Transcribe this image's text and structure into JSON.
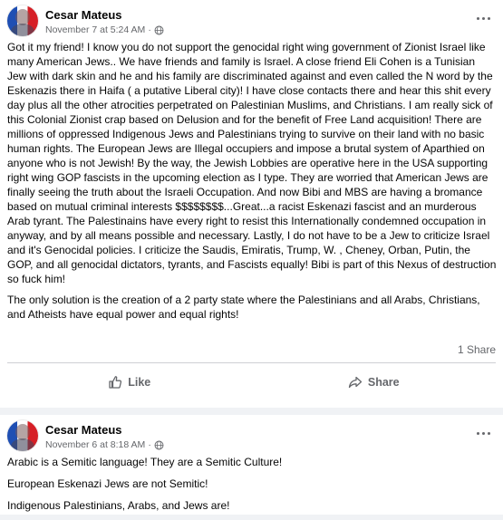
{
  "posts": [
    {
      "author": "Cesar Mateus",
      "timestamp": "November 7 at 5:24 AM",
      "separator": "·",
      "paragraphs": [
        "Got it my friend! I know you do not support the genocidal right wing government of Zionist Israel like many American Jews.. We have friends and family is Israel. A close friend Eli Cohen is a Tunisian Jew with dark skin and he and his family are discriminated against and even called the N word by the Eskenazis there in Haifa ( a putative Liberal city)! I have close contacts there and hear this shit every day plus all the other atrocities perpetrated on Palestinian Muslims, and Christians. I am really sick of this Colonial Zionist crap based on Delusion and for the benefit of Free Land acquisition! There are millions of oppressed Indigenous Jews and Palestinians trying to survive on their land with no basic human rights. The European Jews are Illegal occupiers and impose a brutal system of Aparthied on anyone who is not Jewish! By the way, the Jewish Lobbies are operative here in the USA supporting right wing GOP fascists in the upcoming election as I type. They are worried that American Jews are finally seeing the truth about the Israeli Occupation. And now Bibi and MBS are having a bromance based on mutual criminal interests $$$$$$$$...Great...a racist Eskenazi fascist and an murderous Arab tyrant. The Palestinains have every right to resist this Internationally condemned occupation in anyway, and by all means possible and necessary. Lastly, I do not have to be a Jew to criticize Israel and it's Genocidal policies. I criticize the Saudis, Emiratis, Trump, W. , Cheney,  Orban, Putin, the GOP, and all genocidal dictators, tyrants, and Fascists equally! Bibi is part of this Nexus of destruction so fuck him!",
        "The only solution is the creation of a 2 party state where the Palestinians and all Arabs, Christians, and Atheists have equal power and equal rights!"
      ],
      "share_count": "1 Share",
      "actions": {
        "like": "Like",
        "share": "Share"
      }
    },
    {
      "author": "Cesar Mateus",
      "timestamp": "November 6 at 8:18 AM",
      "separator": "·",
      "paragraphs": [
        "Arabic is a Semitic language! They are a Semitic Culture!",
        "European Eskenazi Jews are not Semitic!",
        "Indigenous Palestinians, Arabs, and Jews are!"
      ]
    }
  ],
  "icons": {
    "globe": "globe-icon",
    "more": "more-options-icon",
    "like": "thumbs-up-icon",
    "share": "share-arrow-icon"
  },
  "colors": {
    "background": "#f0f2f5",
    "card": "#ffffff",
    "secondary_text": "#65676b",
    "divider": "#ced0d4"
  }
}
